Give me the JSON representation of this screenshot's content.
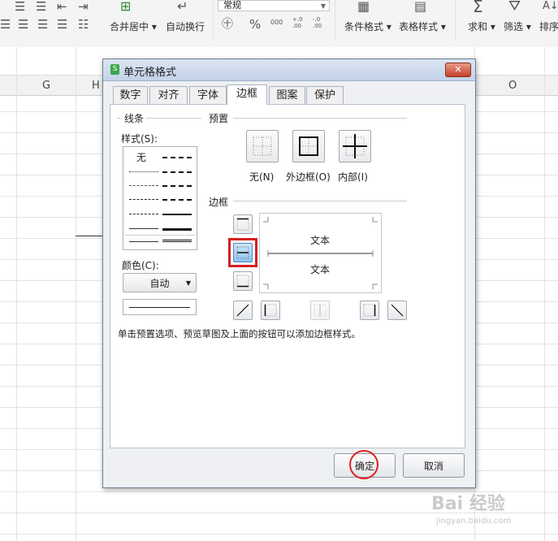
{
  "ribbon": {
    "number_format_value": "常规",
    "merge_center_label": "合并居中",
    "wrap_text_label": "自动换行",
    "cond_format_label": "条件格式",
    "table_style_label": "表格样式",
    "sum_label": "求和",
    "filter_label": "筛选",
    "sort_label": "排序",
    "percent_icon": "%",
    "thousands_icon": "000",
    "inc_decimal_icon": "+.0 .00",
    "dec_decimal_icon": "-.0 .00"
  },
  "sheet": {
    "columns": [
      "G",
      "H",
      "O"
    ]
  },
  "dialog": {
    "title": "单元格格式",
    "close_label": "✕",
    "tabs": [
      "数字",
      "对齐",
      "字体",
      "边框",
      "图案",
      "保护"
    ],
    "active_tab": "边框",
    "line_group": {
      "title": "线条",
      "style_label": "样式(S):",
      "none_label": "无",
      "color_label": "颜色(C):",
      "color_value": "自动"
    },
    "preset_group": {
      "title": "预置",
      "presets": [
        {
          "label": "无(N)",
          "icon": "no-border-icon"
        },
        {
          "label": "外边框(O)",
          "icon": "outline-border-icon"
        },
        {
          "label": "内部(I)",
          "icon": "inside-border-icon"
        }
      ]
    },
    "border_group": {
      "title": "边框",
      "preview_text_top": "文本",
      "preview_text_bottom": "文本",
      "selected_button": "middle-horizontal"
    },
    "hint": "单击预置选项、预览草图及上面的按钮可以添加边框样式。",
    "ok_label": "确定",
    "cancel_label": "取消"
  },
  "watermark": {
    "text": "Bai 经验",
    "sub": "jingyan.baidu.com"
  },
  "colors": {
    "selection_highlight": "#e02020",
    "selected_button": "#8fc3ef"
  }
}
